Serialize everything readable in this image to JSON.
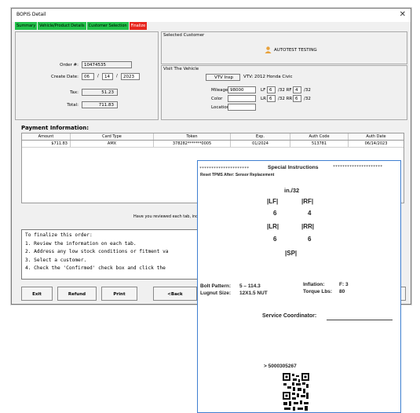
{
  "window": {
    "title": "BOPIS Detail",
    "close": "✕"
  },
  "tabs": [
    "Summary",
    "Vehicle/Product Details",
    "Customer Selection",
    "Finalize"
  ],
  "order": {
    "order_label": "Order #:",
    "order_value": "10474535",
    "create_label": "Create Date:",
    "month": "06",
    "day": "14",
    "year": "2023",
    "sep": "/",
    "tax_label": "Tax:",
    "tax_value": "51.23",
    "total_label": "Total:",
    "total_value": "711.83"
  },
  "customer": {
    "group_label": "Selected Customer",
    "name": "AUTOTEST TESTING"
  },
  "vehicle": {
    "group_label": "Visit The Vehicle",
    "inspect_btn": "VTV Insp",
    "vtv_text": "VTV: 2012 Honda Civic",
    "mileage_label": "Mileage",
    "mileage_value": "98000",
    "color_label": "Color",
    "location_label": "Location",
    "lf_label": "LF",
    "lf_value": "6",
    "rf_label": "/32 RF",
    "rf_value": "4",
    "lr_label": "LR",
    "lr_value": "6",
    "rr_label": "/32 RR",
    "rr_value": "6",
    "unit": "/32"
  },
  "payment": {
    "title": "Payment Information:",
    "columns": [
      "Amount",
      "Card Type",
      "Token",
      "Exp.",
      "Auth Code",
      "Auth Date"
    ],
    "row": [
      "$711.83",
      "AMX",
      "378282*******0005",
      "01/2024",
      "513781",
      "06/14/2023"
    ]
  },
  "question": "Have you reviewed each tab, including p",
  "instructions": [
    "To finalize this order:",
    "1. Review the information on each tab.",
    "2. Address any low stock conditions or fitment va",
    "3. Select a customer.",
    "4. Check the 'Confirmed' check box and click the"
  ],
  "buttons": {
    "exit": "Exit",
    "refund": "Refund",
    "print": "Print",
    "back": "<Back"
  },
  "receipt": {
    "stars": "*********************",
    "heading": "Special Instructions",
    "reset": "Reset TPMS After: Sensor Replacement",
    "unit": "in./32",
    "lf": "|LF|",
    "lf_v": "6",
    "rf": "|RF|",
    "rf_v": "4",
    "lr": "|LR|",
    "lr_v": "6",
    "rr": "|RR|",
    "rr_v": "6",
    "sp": "|SP|",
    "bolt": "Bolt Pattern:",
    "bolt_v": "5 – 114.3",
    "lugnut": "Lugnut Size:",
    "lugnut_v": "12X1.5 NUT",
    "inflation": "Inflation:",
    "inflation_v": "F: 3",
    "torque": "Torque Lbs:",
    "torque_v": "80",
    "coordinator": "Service Coordinator:",
    "code": "> 5000305267"
  },
  "colors": {
    "tab_green": "#21c14a",
    "tab_red": "#e8271f",
    "receipt_border": "#3f7fd1"
  }
}
